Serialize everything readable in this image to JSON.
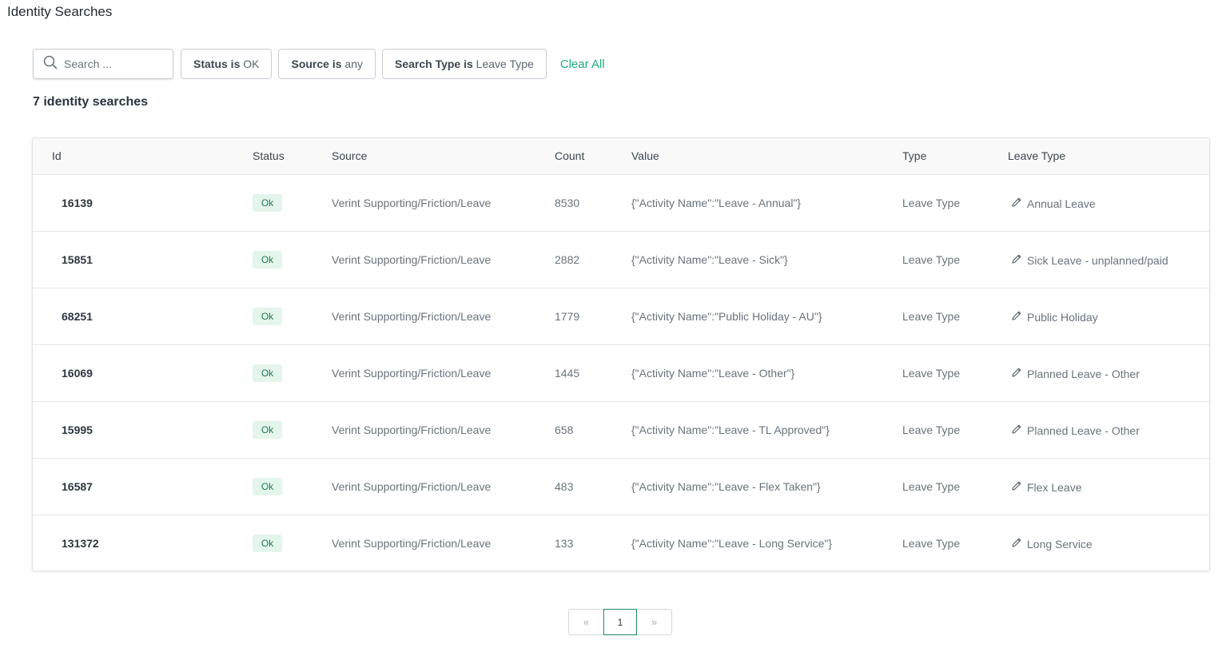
{
  "page": {
    "title": "Identity Searches"
  },
  "filters": {
    "search_placeholder": "Search ...",
    "chips": [
      {
        "key": "Status is",
        "value": "OK"
      },
      {
        "key": "Source is",
        "value": "any"
      },
      {
        "key": "Search Type is",
        "value": "Leave Type"
      }
    ],
    "clear_all": "Clear All"
  },
  "results_count": "7 identity searches",
  "table": {
    "headers": [
      "Id",
      "Status",
      "Source",
      "Count",
      "Value",
      "Type",
      "Leave Type"
    ],
    "rows": [
      {
        "id": "16139",
        "status": "Ok",
        "source": "Verint Supporting/Friction/Leave",
        "count": "8530",
        "value": "{\"Activity Name\":\"Leave - Annual\"}",
        "type": "Leave Type",
        "leave_type": "Annual Leave"
      },
      {
        "id": "15851",
        "status": "Ok",
        "source": "Verint Supporting/Friction/Leave",
        "count": "2882",
        "value": "{\"Activity Name\":\"Leave - Sick\"}",
        "type": "Leave Type",
        "leave_type": "Sick Leave - unplanned/paid"
      },
      {
        "id": "68251",
        "status": "Ok",
        "source": "Verint Supporting/Friction/Leave",
        "count": "1779",
        "value": "{\"Activity Name\":\"Public Holiday - AU\"}",
        "type": "Leave Type",
        "leave_type": "Public Holiday"
      },
      {
        "id": "16069",
        "status": "Ok",
        "source": "Verint Supporting/Friction/Leave",
        "count": "1445",
        "value": "{\"Activity Name\":\"Leave - Other\"}",
        "type": "Leave Type",
        "leave_type": "Planned Leave - Other"
      },
      {
        "id": "15995",
        "status": "Ok",
        "source": "Verint Supporting/Friction/Leave",
        "count": "658",
        "value": "{\"Activity Name\":\"Leave - TL Approved\"}",
        "type": "Leave Type",
        "leave_type": "Planned Leave - Other"
      },
      {
        "id": "16587",
        "status": "Ok",
        "source": "Verint Supporting/Friction/Leave",
        "count": "483",
        "value": "{\"Activity Name\":\"Leave - Flex Taken\"}",
        "type": "Leave Type",
        "leave_type": "Flex Leave"
      },
      {
        "id": "131372",
        "status": "Ok",
        "source": "Verint Supporting/Friction/Leave",
        "count": "133",
        "value": "{\"Activity Name\":\"Leave - Long Service\"}",
        "type": "Leave Type",
        "leave_type": "Long Service"
      }
    ]
  },
  "pagination": {
    "prev": "«",
    "current": "1",
    "next": "»"
  },
  "colors": {
    "accent": "#1fae7a",
    "badge_bg": "#e4f5ec",
    "badge_text": "#1e7d4c"
  },
  "icons": {
    "search": "search-icon",
    "edit": "pencil-icon"
  }
}
